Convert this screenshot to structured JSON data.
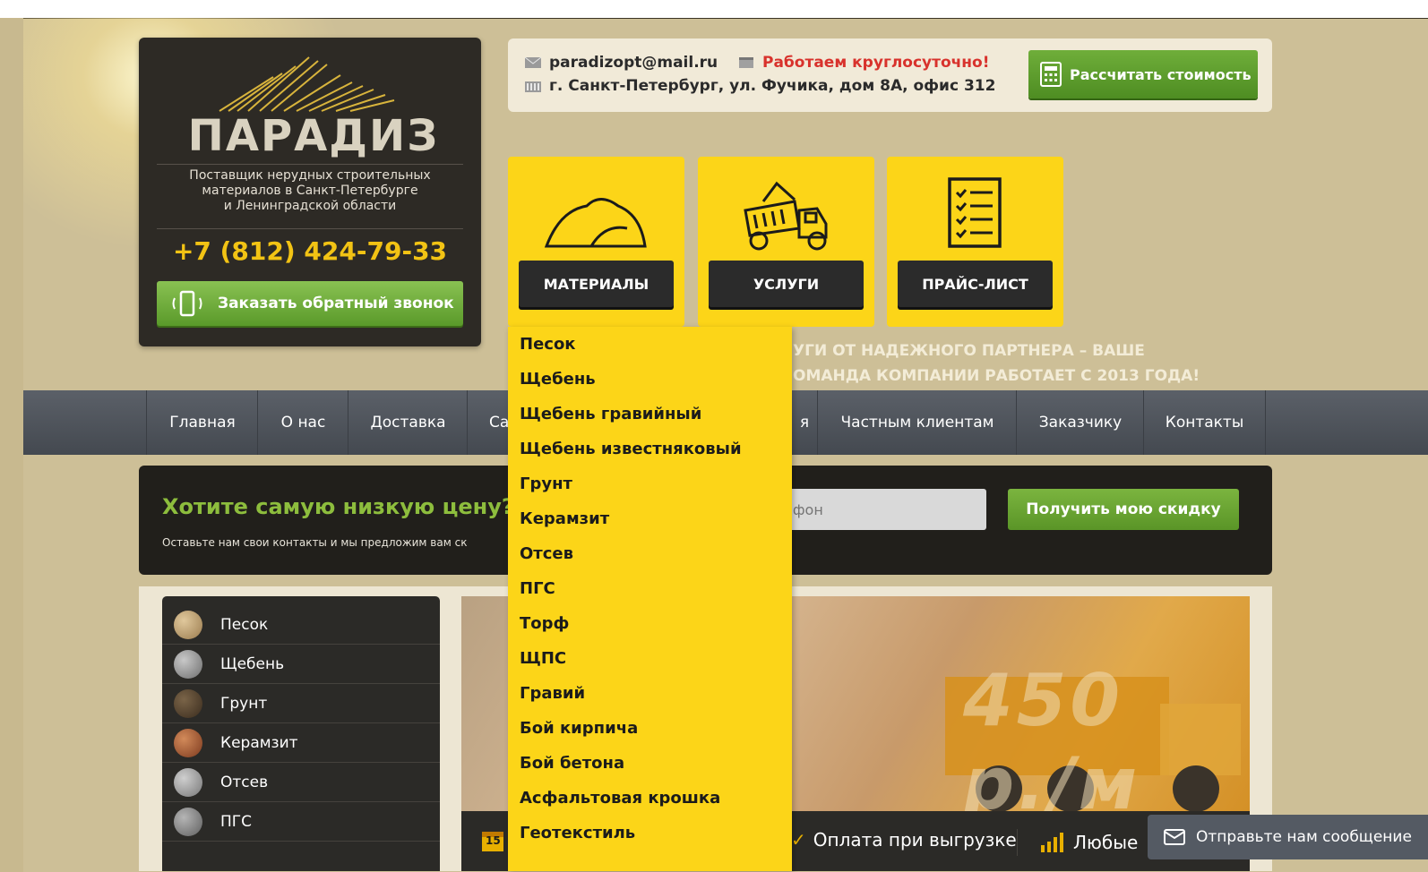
{
  "header": {
    "logo": {
      "word": "ПАРАДИЗ",
      "tagline_lines": [
        "Поставщик нерудных строительных",
        "материалов в Санкт-Петербурге",
        "и Ленинградской области"
      ],
      "phone": "+7 (812) 424-79-33",
      "callback_label": "Заказать обратный звонок"
    },
    "contacts": {
      "email": "paradizopt@mail.ru",
      "hours": "Работаем круглосуточно!",
      "address": "г. Санкт-Петербург, ул. Фучика, дом 8А, офис 312",
      "calc_label": "Рассчитать стоимость"
    },
    "tiles": [
      {
        "label": "МАТЕРИАЛЫ",
        "icon": "pile-icon"
      },
      {
        "label": "УСЛУГИ",
        "icon": "dump-truck-icon"
      },
      {
        "label": "ПРАЙС-ЛИСТ",
        "icon": "checklist-icon"
      }
    ],
    "slogan_lines": [
      "УГИ ОТ НАДЕЖНОГО ПАРТНЕРА – ВАШЕ",
      "ОМАНДА КОМПАНИИ РАБОТАЕТ С 2013 ГОДА!"
    ]
  },
  "nav": {
    "items": [
      "Главная",
      "О нас",
      "Доставка",
      "Са",
      "я",
      "Частным клиентам",
      "Заказчику",
      "Контакты"
    ]
  },
  "promo": {
    "title": "Хотите самую низкую цену?",
    "subtitle": "Оставьте нам свои контакты и мы предложим вам ск",
    "phone_placeholder": "ефон",
    "button_label": "Получить мою скидку"
  },
  "dropdown": {
    "items": [
      "Песок",
      "Щебень",
      "Щебень гравийный",
      "Щебень известняковый",
      "Грунт",
      "Керамзит",
      "Отсев",
      "ПГС",
      "Торф",
      "ЩПС",
      "Гравий",
      "Бой кирпича",
      "Бой бетона",
      "Асфальтовая крошка",
      "Геотекстиль"
    ]
  },
  "sidebar": {
    "items": [
      {
        "label": "Песок",
        "color": "#b89a6a"
      },
      {
        "label": "Щебень",
        "color": "#8f8f8f"
      },
      {
        "label": "Грунт",
        "color": "#5a4632"
      },
      {
        "label": "Керамзит",
        "color": "#a55a35"
      },
      {
        "label": "Отсев",
        "color": "#9c9c9c"
      },
      {
        "label": "ПГС",
        "color": "#7d7d7d"
      }
    ]
  },
  "banner": {
    "price_text": "450 р./м",
    "strip": {
      "calendar_day": "15",
      "payment": "Оплата при выгрузке",
      "any": "Любые"
    }
  },
  "message_button": "Отправьте нам сообщение"
}
